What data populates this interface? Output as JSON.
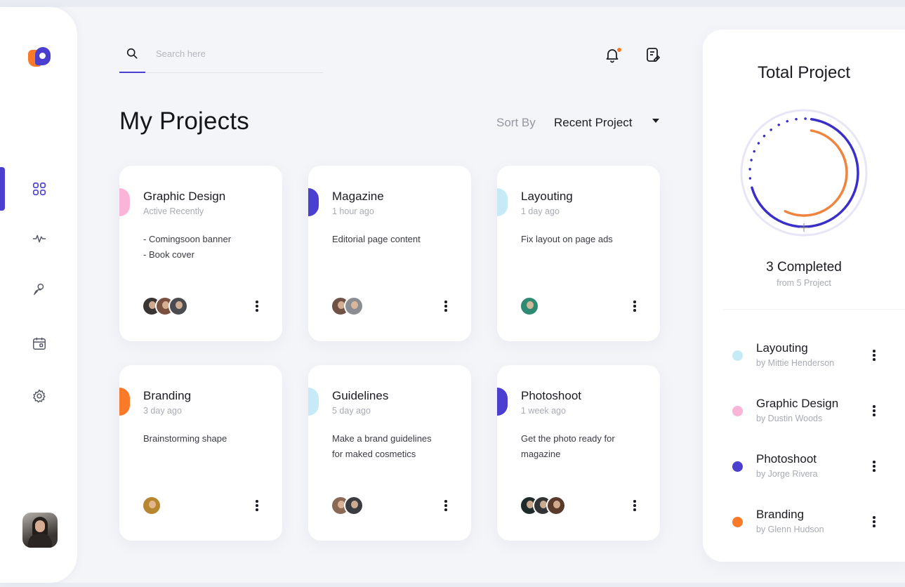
{
  "search": {
    "placeholder": "Search here"
  },
  "page": {
    "title": "My Projects"
  },
  "sort": {
    "label": "Sort By",
    "value": "Recent Project"
  },
  "sidebar": {
    "items": [
      {
        "icon": "dashboard-grid-icon",
        "active": true
      },
      {
        "icon": "activity-pulse-icon",
        "active": false
      },
      {
        "icon": "user-search-icon",
        "active": false
      },
      {
        "icon": "calendar-icon",
        "active": false
      },
      {
        "icon": "settings-gear-icon",
        "active": false
      }
    ]
  },
  "colors": {
    "accent": "#4b3fd0",
    "orange": "#fb7a29",
    "pink": "#f9b4d8",
    "lightblue": "#c7ebf6"
  },
  "cards": [
    {
      "title": "Graphic Design",
      "time": "Active Recently",
      "desc": [
        "- Comingsoon banner",
        "- Book cover"
      ],
      "color": "#f9b4d8",
      "avatars": 3
    },
    {
      "title": "Magazine",
      "time": "1 hour ago",
      "desc": [
        "Editorial page content"
      ],
      "color": "#4b3fd0",
      "avatars": 2
    },
    {
      "title": "Layouting",
      "time": "1 day ago",
      "desc": [
        "Fix layout on page ads"
      ],
      "color": "#c7ebf6",
      "avatars": 1
    },
    {
      "title": "Branding",
      "time": "3 day ago",
      "desc": [
        "Brainstorming shape"
      ],
      "color": "#fb7a29",
      "avatars": 1
    },
    {
      "title": "Guidelines",
      "time": "5 day ago",
      "desc": [
        "Make a brand guidelines",
        "for maked cosmetics"
      ],
      "color": "#c7ebf6",
      "avatars": 2
    },
    {
      "title": "Photoshoot",
      "time": "1 week ago",
      "desc": [
        "Get the photo ready for",
        "magazine"
      ],
      "color": "#4b3fd0",
      "avatars": 3
    }
  ],
  "summary": {
    "title": "Total Project",
    "completed": "3 Completed",
    "from": "from 5 Project",
    "completed_count": 3,
    "total_count": 5,
    "items": [
      {
        "name": "Layouting",
        "by": "by Mittie Henderson",
        "color": "#c7ebf6"
      },
      {
        "name": "Graphic Design",
        "by": "by Dustin Woods",
        "color": "#f9b4d8"
      },
      {
        "name": "Photoshoot",
        "by": "by Jorge Rivera",
        "color": "#4b3fd0"
      },
      {
        "name": "Branding",
        "by": "by Glenn Hudson",
        "color": "#fb7a29"
      }
    ]
  }
}
